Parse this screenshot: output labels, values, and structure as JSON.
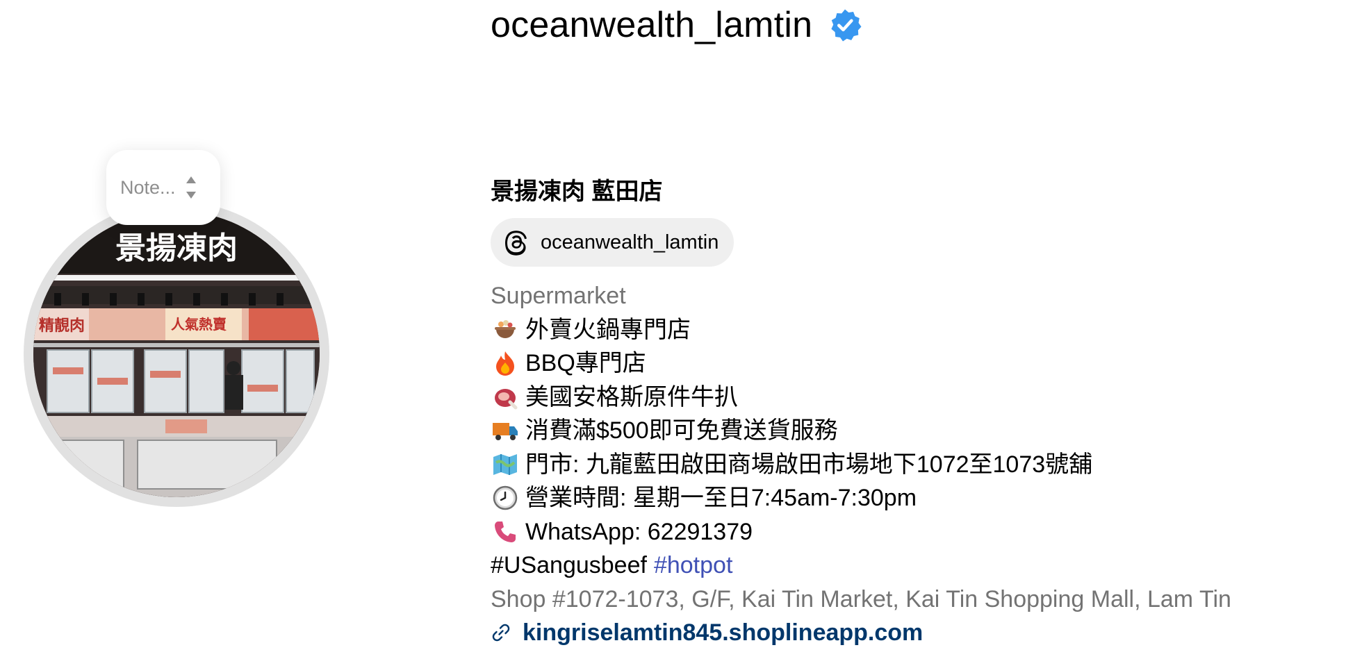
{
  "profile": {
    "username": "oceanwealth_lamtin",
    "display_name": "景揚凍肉 藍田店",
    "threads_handle": "oceanwealth_lamtin",
    "category": "Supermarket",
    "bio_lines": [
      {
        "icon": "hotpot-icon",
        "text": "外賣火鍋專門店"
      },
      {
        "icon": "fire-icon",
        "text": "BBQ專門店"
      },
      {
        "icon": "meat-icon",
        "text": "美國安格斯原件牛扒"
      },
      {
        "icon": "delivery-truck-icon",
        "text": "消費滿$500即可免費送貨服務"
      },
      {
        "icon": "map-icon",
        "text": "門市: 九龍藍田啟田商場啟田市場地下1072至1073號舖"
      },
      {
        "icon": "clock-icon",
        "text": "營業時間: 星期一至日7:45am-7:30pm"
      },
      {
        "icon": "phone-icon",
        "text": "WhatsApp: 62291379"
      }
    ],
    "hashtags": [
      "#USangusbeef",
      "#hotpot"
    ],
    "address": "Shop #1072-1073, G/F, Kai Tin Market, Kai Tin Shopping Mall, Lam Tin",
    "website": "kingriselamtin845.shoplineapp.com"
  },
  "note": {
    "placeholder": "Note..."
  },
  "avatar_image": {
    "sign_text": "景揚凍肉",
    "banner_left": "精靚肉",
    "banner_right": "人氣熱賣"
  },
  "colors": {
    "verified": "#3897f0",
    "hashtag": "#3f50b5",
    "link": "#00376b",
    "secondary_text": "#737373",
    "chip_bg": "#efefef"
  }
}
